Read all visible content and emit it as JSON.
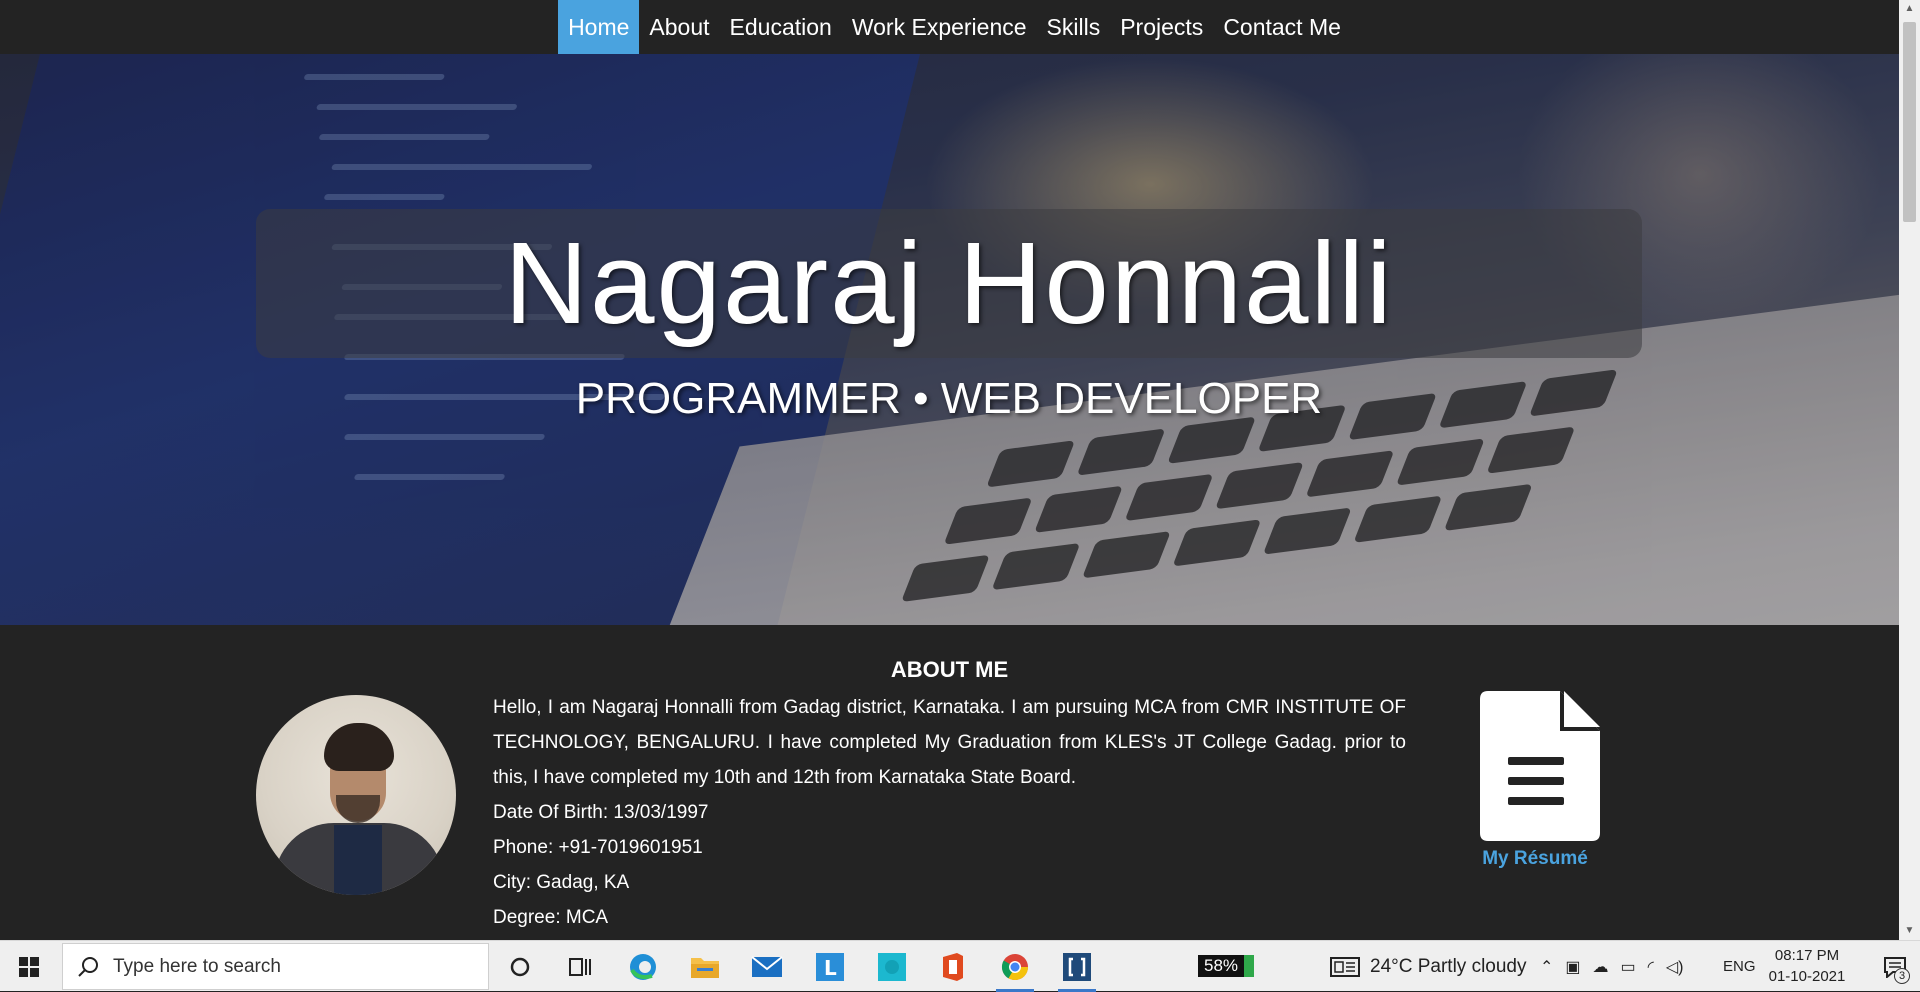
{
  "nav": {
    "items": [
      {
        "label": "Home",
        "active": true
      },
      {
        "label": "About"
      },
      {
        "label": "Education"
      },
      {
        "label": "Work Experience"
      },
      {
        "label": "Skills"
      },
      {
        "label": "Projects"
      },
      {
        "label": "Contact Me"
      }
    ]
  },
  "hero": {
    "name": "Nagaraj Honnalli",
    "subtitle": "PROGRAMMER • WEB DEVELOPER"
  },
  "about": {
    "title": "ABOUT ME",
    "intro": "Hello, I am Nagaraj Honnalli from Gadag district, Karnataka. I am pursuing MCA from CMR INSTITUTE OF TECHNOLOGY, BENGALURU. I have completed My Graduation from KLES's JT College Gadag. prior to this, I have completed my 10th and 12th from Karnataka State Board.",
    "dob": "Date Of Birth: 13/03/1997",
    "phone": "Phone: +91-7019601951",
    "city": "City: Gadag, KA",
    "degree": "Degree: MCA",
    "resume_label": "My Résumé",
    "accent_color": "#4aa3df"
  },
  "taskbar": {
    "search_placeholder": "Type here to search",
    "battery": "58%",
    "weather": "24°C  Partly cloudy",
    "language": "ENG",
    "time": "08:17 PM",
    "date": "01-10-2021",
    "notification_count": "3",
    "icons": [
      "cortana-icon",
      "task-view-icon",
      "edge-icon",
      "file-explorer-icon",
      "mail-icon",
      "l-app-icon",
      "cyan-app-icon",
      "office-icon",
      "chrome-icon",
      "brackets-icon"
    ]
  }
}
